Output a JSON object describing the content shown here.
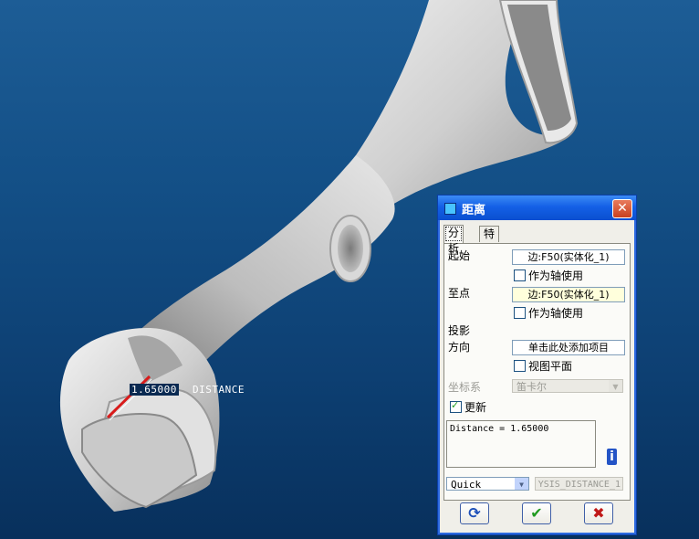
{
  "viewport": {
    "dimension_value": "1.65000",
    "dimension_label": "DISTANCE"
  },
  "dialog": {
    "title": "距离",
    "close_symbol": "✕",
    "tabs": [
      {
        "label": "分析",
        "active": true
      },
      {
        "label": "特征",
        "active": false
      }
    ],
    "start": {
      "label": "起始",
      "value": "边:F50(实体化_1)",
      "axis_checkbox": "作为轴使用",
      "axis_checked": false
    },
    "end": {
      "label": "至点",
      "value": "边:F50(实体化_1)",
      "axis_checkbox": "作为轴使用",
      "axis_checked": false
    },
    "projection": {
      "label_1": "投影",
      "label_2": "方向",
      "value": "单击此处添加项目",
      "view_plane_checkbox": "视图平面",
      "view_plane_checked": false
    },
    "coord_system": {
      "label": "坐标系",
      "value": "笛卡尔"
    },
    "update": {
      "label": "更新",
      "checked": true
    },
    "result_text": "Distance = 1.65000",
    "mode": "Quick",
    "name_field": "YSIS_DISTANCE_1",
    "buttons": {
      "repeat": "⟳",
      "ok": "✔",
      "cancel": "✖"
    }
  }
}
